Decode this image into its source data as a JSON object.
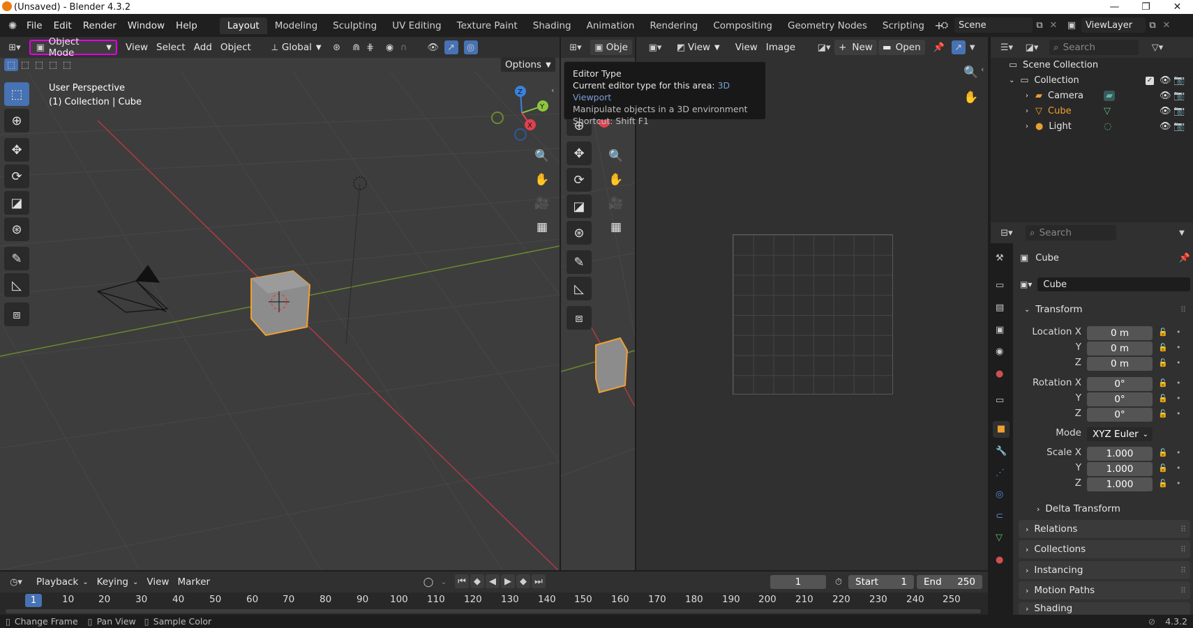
{
  "window": {
    "title": "(Unsaved) - Blender 4.3.2"
  },
  "menu": [
    "File",
    "Edit",
    "Render",
    "Window",
    "Help"
  ],
  "workspaces": [
    "Layout",
    "Modeling",
    "Sculpting",
    "UV Editing",
    "Texture Paint",
    "Shading",
    "Animation",
    "Rendering",
    "Compositing",
    "Geometry Nodes",
    "Scripting"
  ],
  "scene": {
    "name": "Scene",
    "view_layer": "ViewLayer"
  },
  "viewport": {
    "mode": "Object Mode",
    "menus": [
      "View",
      "Select",
      "Add",
      "Object"
    ],
    "transform_orientation": "Global",
    "options_label": "Options",
    "perspective_label": "User Perspective",
    "collection_label": "(1) Collection | Cube",
    "gizmo": {
      "x": "X",
      "y": "Y",
      "z": "Z"
    }
  },
  "viewport2": {
    "mode_partial": "Obje"
  },
  "image_editor": {
    "menus": [
      "View",
      "Image"
    ],
    "view_label": "View",
    "new_label": "New",
    "open_label": "Open"
  },
  "tooltip": {
    "title": "Editor Type",
    "line1_prefix": "Current editor type for this area: ",
    "line1_value": "3D Viewport",
    "line2": "Manipulate objects in a 3D environment",
    "line3": "Shortcut: Shift F1"
  },
  "outliner": {
    "search_placeholder": "Search",
    "scene_collection": "Scene Collection",
    "collection": "Collection",
    "items": [
      {
        "name": "Camera",
        "color": "#e6a032"
      },
      {
        "name": "Cube",
        "color": "#f0a030"
      },
      {
        "name": "Light",
        "color": "#e6a032"
      }
    ]
  },
  "properties": {
    "search_placeholder": "Search",
    "object_name": "Cube",
    "datablock_name": "Cube",
    "transform_label": "Transform",
    "location": {
      "label": "Location X",
      "x": "0 m",
      "y": "0 m",
      "z": "0 m"
    },
    "rotation": {
      "label": "Rotation X",
      "x": "0°",
      "y": "0°",
      "z": "0°"
    },
    "mode": {
      "label": "Mode",
      "value": "XYZ Euler"
    },
    "scale": {
      "label": "Scale X",
      "x": "1.000",
      "y": "1.000",
      "z": "1.000"
    },
    "axis_y": "Y",
    "axis_z": "Z",
    "delta_transform": "Delta Transform",
    "panels": [
      "Relations",
      "Collections",
      "Instancing",
      "Motion Paths",
      "Shading"
    ]
  },
  "timeline": {
    "menus": [
      "Playback",
      "Keying",
      "View",
      "Marker"
    ],
    "current_frame": "1",
    "start_label": "Start",
    "start": "1",
    "end_label": "End",
    "end": "250",
    "ticks": [
      "1",
      "10",
      "20",
      "30",
      "40",
      "50",
      "60",
      "70",
      "80",
      "90",
      "100",
      "110",
      "120",
      "130",
      "140",
      "150",
      "160",
      "170",
      "180",
      "190",
      "200",
      "210",
      "220",
      "230",
      "240",
      "250"
    ]
  },
  "status": {
    "items": [
      "Change Frame",
      "Pan View",
      "Sample Color"
    ],
    "version": "4.3.2"
  },
  "colors": {
    "accent": "#4772b3",
    "highlight_box": "#e000e0",
    "selected": "#f0a030",
    "x_axis": "#e0404e",
    "y_axis": "#8cc63f",
    "z_axis": "#3a82e0"
  }
}
